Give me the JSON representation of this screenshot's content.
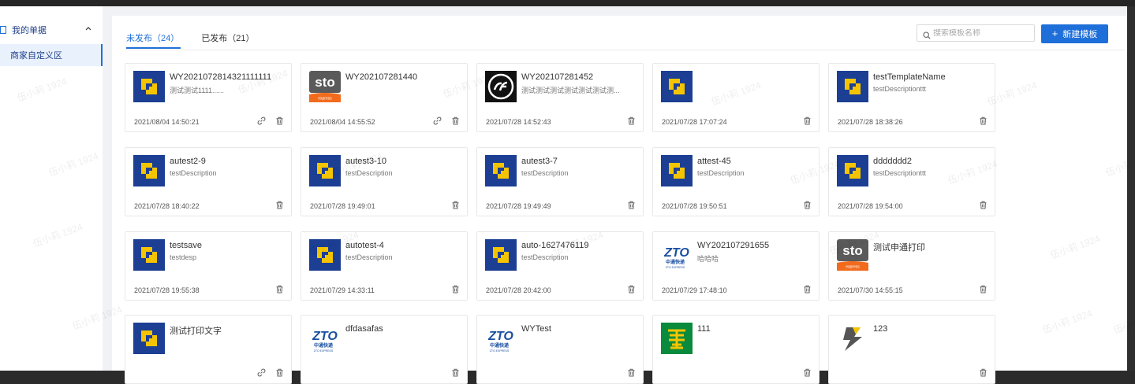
{
  "sidebar": {
    "group_label": "我的单据",
    "item_label": "商家自定义区"
  },
  "tabs": [
    {
      "label": "未发布（24）",
      "active": true
    },
    {
      "label": "已发布（21）",
      "active": false
    }
  ],
  "search": {
    "placeholder": "搜索模板名称"
  },
  "new_button": {
    "label": "新建模板"
  },
  "watermark": "伍小莉 1924",
  "cards": [
    {
      "title": "WY2021072814321111111",
      "desc": "测试测试1111......",
      "date": "2021/08/04 14:50:21",
      "logo": "yunda",
      "link": true
    },
    {
      "title": "WY202107281440",
      "desc": "",
      "date": "2021/08/04 14:55:52",
      "logo": "sto",
      "link": true
    },
    {
      "title": "WY202107281452",
      "desc": "测试测试测试测试测试测试测...",
      "date": "2021/07/28 14:52:43",
      "logo": "sf",
      "link": false
    },
    {
      "title": "",
      "desc": "",
      "date": "2021/07/28 17:07:24",
      "logo": "yunda",
      "link": false
    },
    {
      "title": "testTemplateName",
      "desc": "testDescriptionttt",
      "date": "2021/07/28 18:38:26",
      "logo": "yunda",
      "link": false
    },
    {
      "title": "autest2-9",
      "desc": "testDescription",
      "date": "2021/07/28 18:40:22",
      "logo": "yunda",
      "link": false
    },
    {
      "title": "autest3-10",
      "desc": "testDescription",
      "date": "2021/07/28 19:49:01",
      "logo": "yunda",
      "link": false
    },
    {
      "title": "autest3-7",
      "desc": "testDescription",
      "date": "2021/07/28 19:49:49",
      "logo": "yunda",
      "link": false
    },
    {
      "title": "attest-45",
      "desc": "testDescription",
      "date": "2021/07/28 19:50:51",
      "logo": "yunda",
      "link": false
    },
    {
      "title": "ddddddd2",
      "desc": "testDescriptionttt",
      "date": "2021/07/28 19:54:00",
      "logo": "yunda",
      "link": false
    },
    {
      "title": "testsave",
      "desc": "testdesp",
      "date": "2021/07/28 19:55:38",
      "logo": "yunda",
      "link": false
    },
    {
      "title": "autotest-4",
      "desc": "testDescription",
      "date": "2021/07/29 14:33:11",
      "logo": "yunda",
      "link": false
    },
    {
      "title": "auto-1627476119",
      "desc": "testDescription",
      "date": "2021/07/28 20:42:00",
      "logo": "yunda",
      "link": false
    },
    {
      "title": "WY202107291655",
      "desc": "哈哈哈",
      "date": "2021/07/29 17:48:10",
      "logo": "zto",
      "link": false
    },
    {
      "title": "测试申通打印",
      "desc": "",
      "date": "2021/07/30 14:55:15",
      "logo": "sto",
      "link": false
    },
    {
      "title": "测试打印文字",
      "desc": "",
      "date": "",
      "logo": "yunda",
      "link": true
    },
    {
      "title": "dfdasafas",
      "desc": "",
      "date": "",
      "logo": "zto",
      "link": false
    },
    {
      "title": "WYTest",
      "desc": "",
      "date": "",
      "logo": "zto",
      "link": false
    },
    {
      "title": "111",
      "desc": "",
      "date": "",
      "logo": "ems",
      "link": false
    },
    {
      "title": "123",
      "desc": "",
      "date": "",
      "logo": "bolt",
      "link": false
    }
  ],
  "logo_text": {
    "sto": "sto",
    "sto_sub": "express",
    "zto": "ZTO",
    "zto_cn": "中通快递",
    "zto_en": "ZTO EXPRESS"
  },
  "colors": {
    "accent": "#1e6fd9",
    "yunda_blue": "#1c3f94",
    "yunda_yellow": "#f5c400",
    "sto_orange": "#f26b1d",
    "ems_green": "#0a8a3c"
  }
}
